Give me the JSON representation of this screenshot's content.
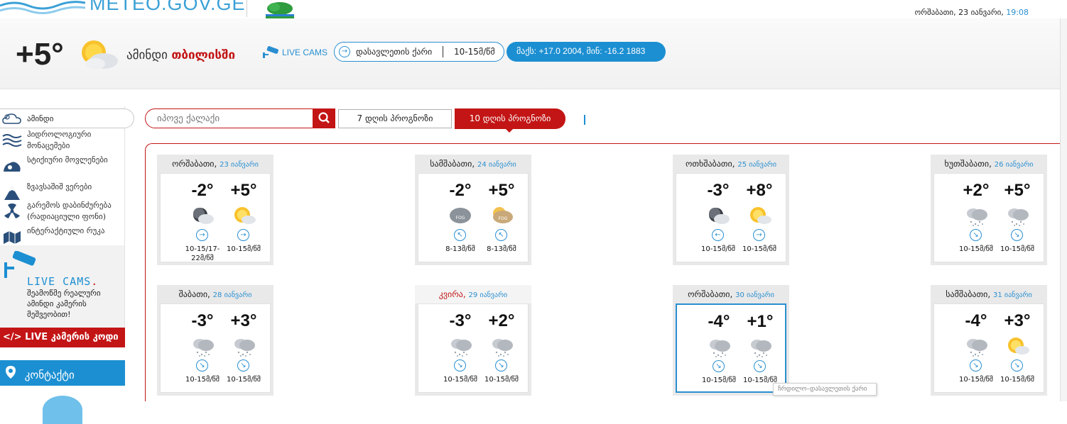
{
  "site": {
    "logo_text": "METEO.GOV.GE",
    "date": "ორშაბათი, 23 იანვარი,",
    "time": "19:08"
  },
  "current": {
    "temperature": "+5°",
    "today_prefix": "ამინდი",
    "city": "თბილისში",
    "live_cams_label": "LIVE CAMS",
    "wind_direction": "დასავლეთის ქარი",
    "wind_speed": "10-15მ/წმ",
    "record": "მაქს: +17.0 2004, მინ: -16.2 1883",
    "icon": "sun-cloud-icon"
  },
  "sidebar": {
    "header": "ამინდი",
    "items": [
      {
        "label": "ჰიდროლოგიური მონაცემები",
        "icon": "hydrology-icon"
      },
      {
        "label": "სტიქიური მოვლენები",
        "icon": "disaster-icon"
      },
      {
        "label": "ზვავსაშიშ ვერები",
        "icon": "avalanche-icon"
      },
      {
        "label": "გარემოს დაბინძურება (რადიაციული ფონი)",
        "icon": "radiation-icon"
      },
      {
        "label": "ინტერაქტიული რუკა",
        "icon": "map-icon"
      }
    ],
    "livecams_title": "LIVE CAMS",
    "livecams_desc": "შეამოწმე რეალური ამინდი კამერის მეშვეობით!",
    "livecode_label": "LIVE კამერის კოდი",
    "contact_label": "კონტაქტი"
  },
  "search": {
    "placeholder": "იპოვე ქალაქი"
  },
  "tabs": {
    "seven_day": "7 დღის პროგნოზი",
    "ten_day": "10 დღის პროგნოზი"
  },
  "forecast": [
    {
      "weekday": "ორშაბათი,",
      "date": "23 იანვარი",
      "night": {
        "temp": "-2°",
        "icon": "moon-cloud-icon",
        "arrow": "→",
        "wind": "10-15/17-22მ/წმ"
      },
      "day": {
        "temp": "+5°",
        "icon": "sun-cloud-icon",
        "arrow": "→",
        "wind": "10-15მ/წმ"
      }
    },
    {
      "weekday": "სამშაბათი,",
      "date": "24 იანვარი",
      "night": {
        "temp": "-2°",
        "icon": "fog-icon",
        "arrow": "↖",
        "wind": "8-13მ/წმ"
      },
      "day": {
        "temp": "+5°",
        "icon": "fog-sun-icon",
        "arrow": "↖",
        "wind": "8-13მ/წმ"
      }
    },
    {
      "weekday": "ოთხშაბათი,",
      "date": "25 იანვარი",
      "night": {
        "temp": "-3°",
        "icon": "moon-cloud-icon",
        "arrow": "←",
        "wind": "10-15მ/წმ"
      },
      "day": {
        "temp": "+8°",
        "icon": "sun-cloud-icon",
        "arrow": "→",
        "wind": "10-15მ/წმ"
      }
    },
    {
      "weekday": "ხუთშაბათი,",
      "date": "26 იანვარი",
      "night": {
        "temp": "+2°",
        "icon": "snow-cloud-icon",
        "arrow": "↘",
        "wind": "10-15მ/წმ"
      },
      "day": {
        "temp": "+5°",
        "icon": "snow-cloud-icon",
        "arrow": "↘",
        "wind": "10-15მ/წმ"
      }
    },
    {
      "weekday": "შაბათი,",
      "date": "28 იანვარი",
      "night": {
        "temp": "-3°",
        "icon": "snow-cloud-icon",
        "arrow": "↘",
        "wind": "10-15მ/წმ"
      },
      "day": {
        "temp": "+3°",
        "icon": "snow-cloud-icon",
        "arrow": "↘",
        "wind": "10-15მ/წმ"
      }
    },
    {
      "weekday": "კვირა,",
      "date": "29 იანვარი",
      "sunday": true,
      "night": {
        "temp": "-3°",
        "icon": "snow-cloud-icon",
        "arrow": "↘",
        "wind": "10-15მ/წმ"
      },
      "day": {
        "temp": "+2°",
        "icon": "snow-cloud-icon",
        "arrow": "↘",
        "wind": "10-15მ/წმ"
      }
    },
    {
      "weekday": "ორშაბათი,",
      "date": "30 იანვარი",
      "selected": true,
      "night": {
        "temp": "-4°",
        "icon": "snow-cloud-icon",
        "arrow": "↘",
        "wind": "10-15მ/წმ"
      },
      "day": {
        "temp": "+1°",
        "icon": "snow-cloud-icon",
        "arrow": "↘",
        "wind": "10-15მ/წმ"
      }
    },
    {
      "weekday": "სამშაბათი,",
      "date": "31 იანვარი",
      "night": {
        "temp": "-4°",
        "icon": "snow-cloud-icon",
        "arrow": "↘",
        "wind": "10-15მ/წმ"
      },
      "day": {
        "temp": "+3°",
        "icon": "sun-cloud-icon",
        "arrow": "↘",
        "wind": "10-15მ/წმ"
      }
    }
  ],
  "tooltip": "ჩრდილო–დასავლეთის ქარი",
  "colors": {
    "brand_red": "#c31515",
    "brand_blue": "#1c8fd2"
  }
}
